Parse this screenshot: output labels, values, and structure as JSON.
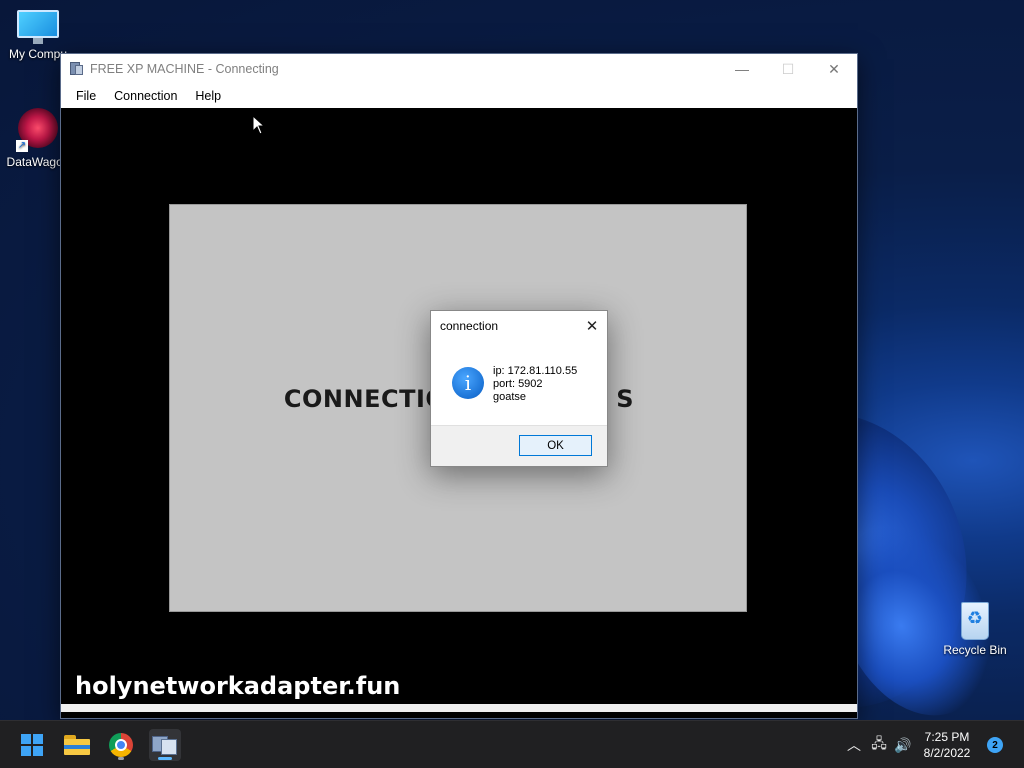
{
  "desktop": {
    "icons": [
      {
        "label": "My Compu"
      },
      {
        "label": "DataWagon"
      },
      {
        "label": "Recycle Bin"
      }
    ]
  },
  "window": {
    "title": "FREE XP MACHINE - Connecting",
    "controls": {
      "minimize": "—",
      "maximize": "☐",
      "close": "✕"
    },
    "menu": [
      "File",
      "Connection",
      "Help"
    ],
    "remote": {
      "status_left": "CONNECTIO",
      "status_right": "S",
      "watermark": "holynetworkadapter.fun"
    }
  },
  "dialog": {
    "title": "connection",
    "close": "✕",
    "icon": "i",
    "lines": [
      "ip: 172.81.110.55",
      "port: 5902",
      "goatse"
    ],
    "ok_label": "OK"
  },
  "taskbar": {
    "icons": [
      "start-icon",
      "file-explorer-icon",
      "chrome-icon",
      "vnc-viewer-icon"
    ],
    "tray": {
      "chevron": "︿",
      "network": "🖧",
      "volume": "🔊",
      "time": "7:25 PM",
      "date": "8/2/2022",
      "notifications": "2"
    }
  },
  "colors": {
    "accent": "#0078d7",
    "desktop_bg": "#0a1e48",
    "taskbar_bg": "#202022"
  }
}
